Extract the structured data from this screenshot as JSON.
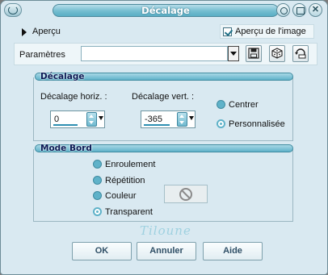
{
  "window": {
    "title": "Décalage"
  },
  "apercu": {
    "label": "Aperçu",
    "preview_checkbox_label": "Aperçu de l'image",
    "preview_checked": true
  },
  "params": {
    "label": "Paramètres",
    "value": ""
  },
  "offset_group": {
    "title": "Décalage",
    "horiz_label": "Décalage horiz. :",
    "horiz_value": "0",
    "vert_label": "Décalage vert. :",
    "vert_value": "-365",
    "option_center": "Centrer",
    "option_custom": "Personnalisée",
    "selected": "Personnalisée"
  },
  "edge_group": {
    "title": "Mode Bord",
    "options": [
      "Enroulement",
      "Répétition",
      "Couleur",
      "Transparent"
    ],
    "selected": "Transparent"
  },
  "watermark": "Tiloune",
  "buttons": {
    "ok": "OK",
    "cancel": "Annuler",
    "help": "Aide"
  },
  "colors": {
    "accent": "#5fb2c9",
    "background": "#d9e9f1",
    "title_text": "#ffffff",
    "group_title": "#0b1a55"
  }
}
